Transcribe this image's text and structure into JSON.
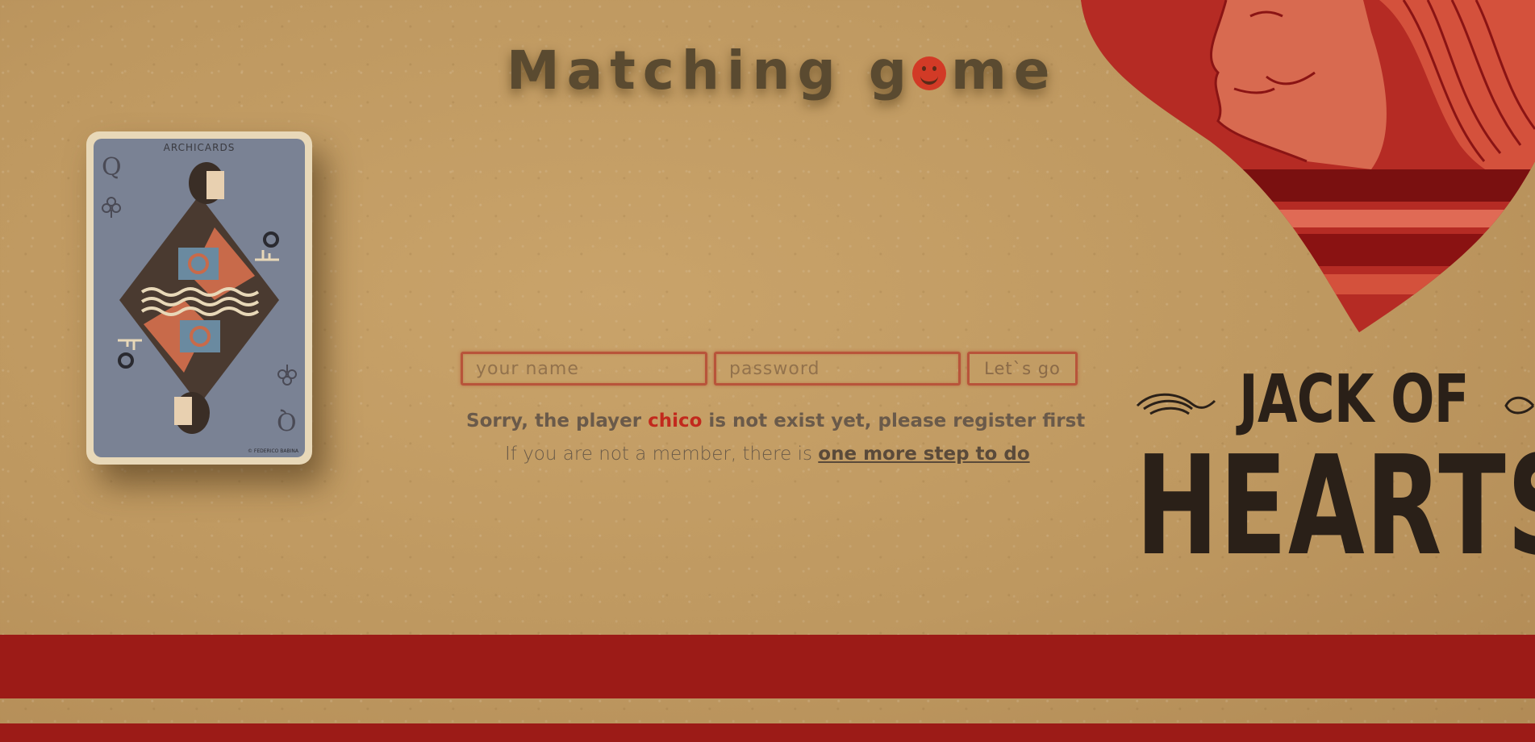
{
  "title": {
    "part1": "Matching g",
    "part2": "me",
    "icon": "smiley-face-icon"
  },
  "card": {
    "brand": "ARCHICARDS",
    "rank": "Q",
    "suit": "clubs",
    "credit": "© FEDERICO BABINA"
  },
  "form": {
    "name_placeholder": "your name",
    "password_placeholder": "password",
    "submit_label": "Let`s go"
  },
  "message": {
    "prefix": "Sorry, the player ",
    "player": "chico",
    "suffix": " is not exist yet, please register first"
  },
  "register": {
    "text": "If you are not a member, there is ",
    "link": "one more step to do"
  },
  "art": {
    "line1": "JACK OF",
    "line2": "HEARTS"
  },
  "colors": {
    "background": "#c9a36a",
    "accent_red": "#c2291d",
    "stripe_red": "#9c1b17",
    "field_border": "#b8543a"
  }
}
